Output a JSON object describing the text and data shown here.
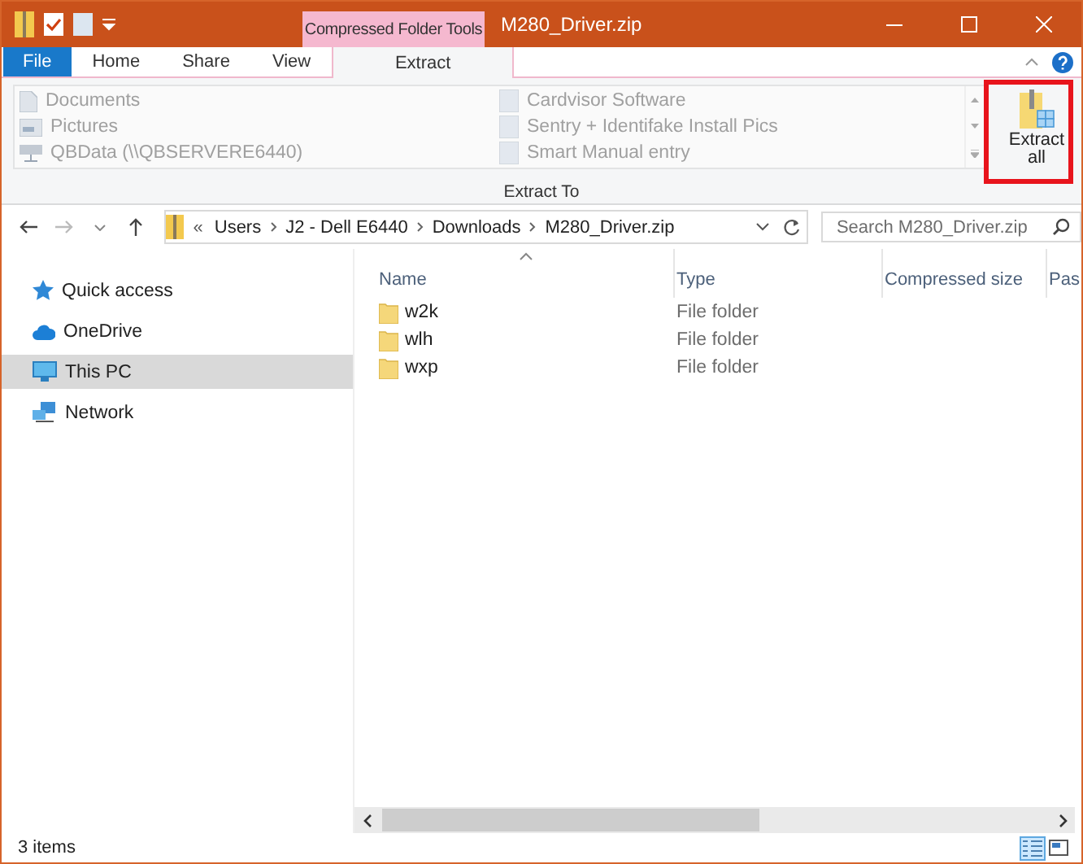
{
  "window": {
    "title": "M280_Driver.zip",
    "context_tab": "Compressed Folder Tools"
  },
  "tabs": [
    {
      "label": "File",
      "kind": "file",
      "selected": false
    },
    {
      "label": "Home",
      "kind": "plain",
      "selected": false
    },
    {
      "label": "Share",
      "kind": "plain",
      "selected": false
    },
    {
      "label": "View",
      "kind": "plain",
      "selected": false
    },
    {
      "label": "Extract",
      "kind": "context",
      "selected": true
    }
  ],
  "ribbon": {
    "destinations": [
      {
        "label": "Documents",
        "kind": "documents",
        "disabled": true
      },
      {
        "label": "Pictures",
        "kind": "pictures",
        "disabled": true
      },
      {
        "label": "QBData (\\\\QBSERVERE6440)",
        "kind": "drive",
        "disabled": true
      },
      {
        "label": "Cardvisor Software",
        "kind": "folder",
        "disabled": true
      },
      {
        "label": "Sentry + Identifake Install Pics",
        "kind": "folder",
        "disabled": true
      },
      {
        "label": "Smart Manual entry",
        "kind": "folder",
        "disabled": true
      }
    ],
    "group_label": "Extract To",
    "extract_all": {
      "label": "Extract all",
      "highlighted": true
    }
  },
  "address": {
    "overflow": "«",
    "crumbs": [
      "Users",
      "J2 - Dell E6440",
      "Downloads",
      "M280_Driver.zip"
    ]
  },
  "search": {
    "placeholder": "Search M280_Driver.zip"
  },
  "nav_pane": [
    {
      "label": "Quick access",
      "kind": "star",
      "selected": false
    },
    {
      "label": "OneDrive",
      "kind": "cloud",
      "selected": false
    },
    {
      "label": "This PC",
      "kind": "pc",
      "selected": true
    },
    {
      "label": "Network",
      "kind": "network",
      "selected": false
    }
  ],
  "table": {
    "columns": [
      {
        "label": "Name",
        "sorted": true
      },
      {
        "label": "Type",
        "sorted": false
      },
      {
        "label": "Compressed size",
        "sorted": false
      },
      {
        "label": "Pas",
        "sorted": false
      }
    ],
    "rows": [
      {
        "name": "w2k",
        "type": "File folder"
      },
      {
        "name": "wlh",
        "type": "File folder"
      },
      {
        "name": "wxp",
        "type": "File folder"
      }
    ]
  },
  "status_bar": {
    "items": "3 items",
    "views": [
      {
        "kind": "details",
        "selected": true
      },
      {
        "kind": "thumbnails",
        "selected": false
      }
    ]
  }
}
